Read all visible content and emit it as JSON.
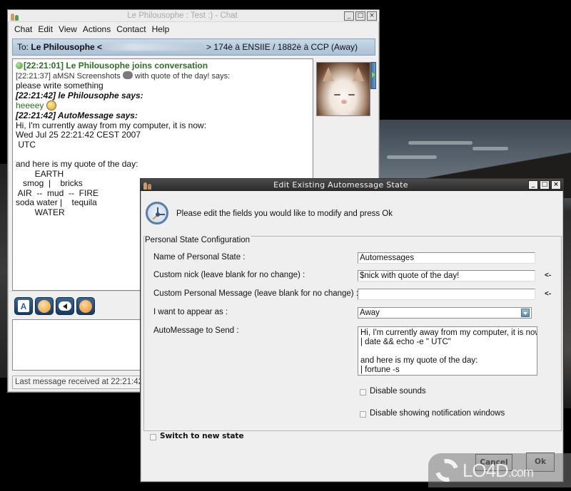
{
  "chat_window": {
    "title": "Le Philousophe : Test :) - Chat",
    "window_buttons": [
      "_",
      "□",
      "×"
    ],
    "menu": [
      "Chat",
      "Edit",
      "View",
      "Actions",
      "Contact",
      "Help"
    ],
    "to_bar": {
      "prefix": "To:",
      "contact_name": "Le Philousophe <",
      "email_redacted": true,
      "suffix": "> 174è à ENSIIE / 1882è à CCP (Away)"
    },
    "history": {
      "join_line": "[22:21:01] Le Philousophe joins conversation",
      "line1_header": "[22:21:37] aMSN Screenshots",
      "line1_header_tail": "with quote of the day! says:",
      "line1_body": "please write something",
      "line2_header": "[22:21:42] le Philousophe says:",
      "line2_body": "heeeey",
      "line3_header": "[22:21:42] AutoMessage says:",
      "line3_body": [
        "Hi, I'm currently away from my computer, it is now:",
        "Wed Jul 25 22:21:42 CEST 2007",
        " UTC",
        "",
        "and here is my quote of the day:",
        "        EARTH",
        "   smog  |    bricks",
        " AIR  --  mud  --  FIRE",
        "soda water |    tequila",
        "        WATER"
      ]
    },
    "toolbar_icons": [
      "font-icon",
      "smiley-icon",
      "voice-clip-icon",
      "wink-icon"
    ],
    "status": "Last message received at 22:21:42"
  },
  "dialog": {
    "title": "Edit Existing Automessage State",
    "window_buttons": [
      "_",
      "□",
      "×"
    ],
    "intro": "Please edit the fields you would like to modify and press Ok",
    "group_title": "Personal State Configuration",
    "fields": {
      "name_label": "Name of Personal State :",
      "name_value": "Automessages",
      "nick_label": "Custom nick (leave blank for no change) :",
      "nick_value": "$nick with quote of the day!",
      "nick_marker": "<-",
      "psm_label": "Custom Personal Message (leave blank for no change) :",
      "psm_value": "",
      "psm_marker": "<-",
      "appear_label": "I want to appear as :",
      "appear_value": "Away",
      "automsg_label": "AutoMessage to Send :",
      "automsg_value": "Hi, I'm currently away from my computer, it is now:\n| date && echo -e \" UTC\"\n\nand here is my quote of the day:\n| fortune -s"
    },
    "checkboxes": {
      "disable_sounds": {
        "label": "Disable sounds",
        "checked": false
      },
      "disable_notifications": {
        "label": "Disable showing notification windows",
        "checked": false
      },
      "switch_state": {
        "label": "Switch to new state",
        "checked": false
      }
    },
    "buttons": {
      "cancel": "Cancel",
      "ok": "Ok"
    }
  },
  "watermark": {
    "brand": "LO4D",
    "suffix": ".com"
  }
}
